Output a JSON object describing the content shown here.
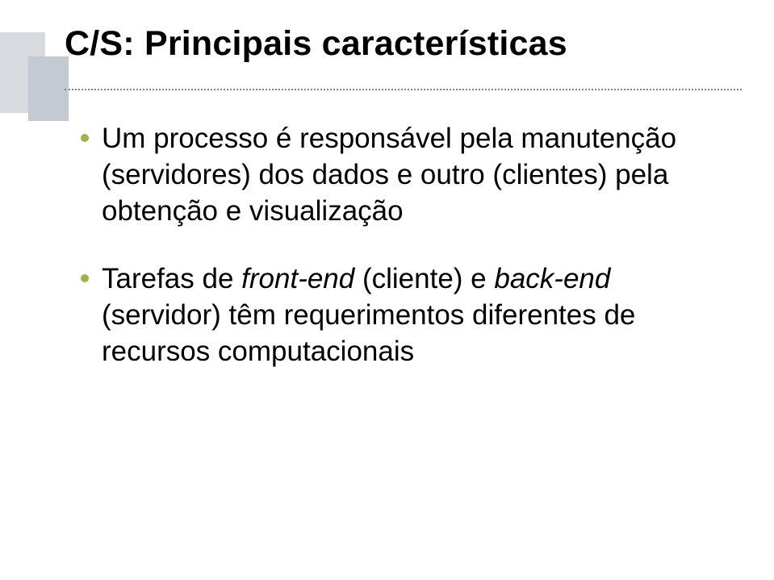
{
  "title": "C/S: Principais características",
  "bullets": [
    {
      "text": "Um processo é responsável pela manutenção (servidores) dos dados e outro (clientes) pela obtenção e visualização"
    },
    {
      "prefix": "Tarefas de ",
      "em1": "front-end",
      "mid": " (cliente) e ",
      "em2": "back-end",
      "suffix": " (servidor) têm requerimentos diferentes de recursos computacionais"
    }
  ]
}
